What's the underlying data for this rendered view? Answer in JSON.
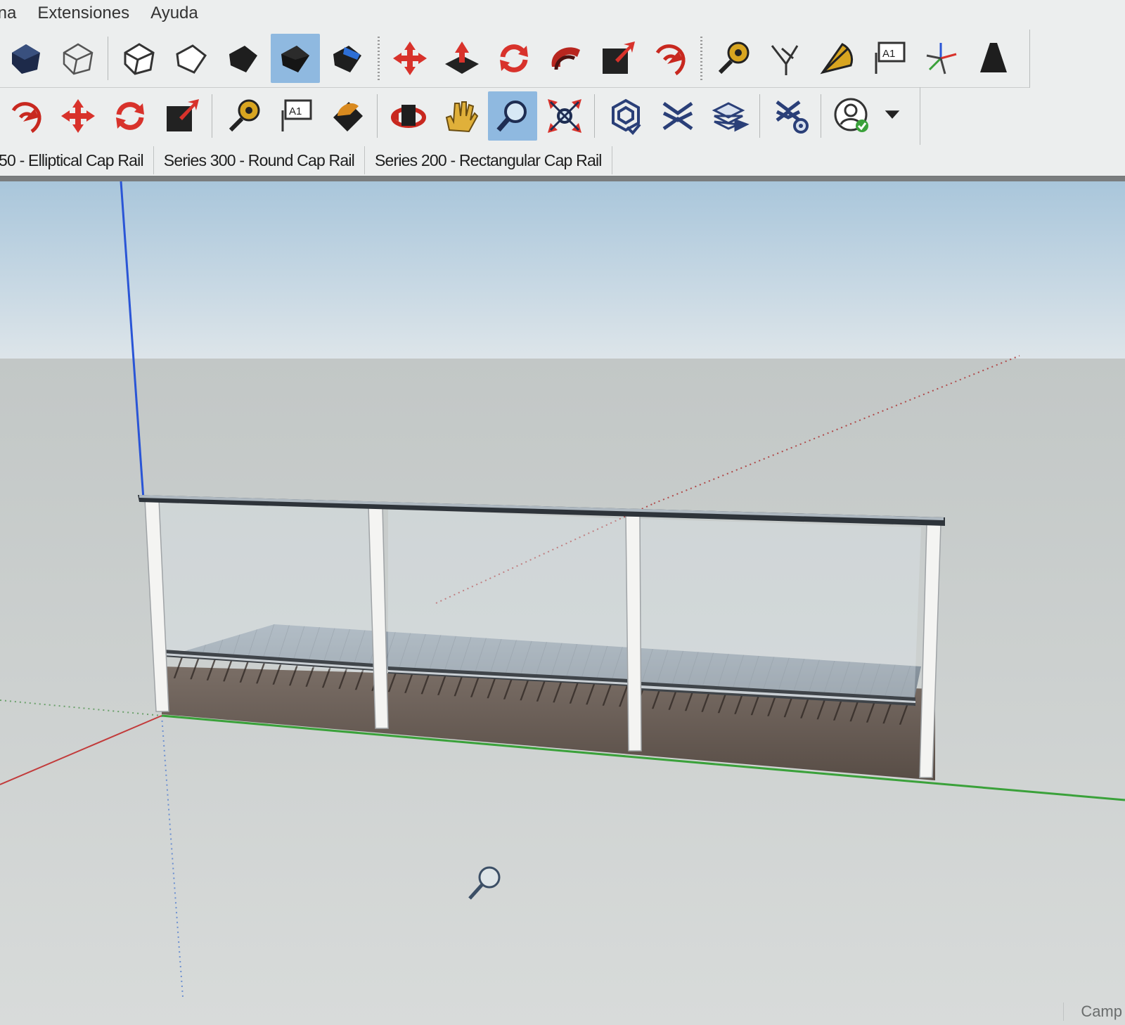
{
  "menubar": {
    "items": [
      "ına",
      "Extensiones",
      "Ayuda"
    ]
  },
  "toolbar_row1": [
    {
      "icon": "x-ray-style-icon"
    },
    {
      "icon": "wireframe-cube-icon"
    },
    {
      "icon": "hidden-line-cube-icon"
    },
    {
      "icon": "shaded-outline-cube-icon"
    },
    {
      "icon": "shaded-cube-icon"
    },
    {
      "icon": "shaded-textures-cube-icon",
      "active": true
    },
    {
      "icon": "monochrome-cube-icon"
    },
    {
      "icon": "move-icon"
    },
    {
      "icon": "push-pull-icon"
    },
    {
      "icon": "rotate-icon"
    },
    {
      "icon": "follow-me-icon"
    },
    {
      "icon": "scale-icon"
    },
    {
      "icon": "offset-icon"
    },
    {
      "icon": "tape-measure-icon"
    },
    {
      "icon": "dimension-icon"
    },
    {
      "icon": "protractor-icon"
    },
    {
      "icon": "text-label-icon"
    },
    {
      "icon": "axes-icon"
    },
    {
      "icon": "3d-text-icon"
    }
  ],
  "toolbar_row2": [
    {
      "icon": "offset-icon"
    },
    {
      "icon": "move-icon"
    },
    {
      "icon": "rotate-icon"
    },
    {
      "icon": "scale-icon"
    },
    {
      "icon": "tape-measure-icon"
    },
    {
      "icon": "text-label-icon"
    },
    {
      "icon": "paint-bucket-icon"
    },
    {
      "icon": "orbit-icon"
    },
    {
      "icon": "pan-icon"
    },
    {
      "icon": "zoom-icon",
      "active": true
    },
    {
      "icon": "zoom-extents-icon"
    },
    {
      "icon": "warehouse-icon"
    },
    {
      "icon": "extension-warehouse-icon"
    },
    {
      "icon": "share-model-icon"
    },
    {
      "icon": "extension-manager-icon"
    },
    {
      "icon": "account-icon"
    },
    {
      "icon": "dropdown-arrow-icon"
    }
  ],
  "tabs": [
    {
      "label": "50 - Elliptical Cap Rail"
    },
    {
      "label": "Series 300 - Round Cap Rail"
    },
    {
      "label": "Series 200 - Rectangular Cap Rail"
    }
  ],
  "status": {
    "text": "Camp"
  },
  "colors": {
    "ui_bg": "#eceeee",
    "active_button": "#8fb9e0",
    "sky_top": "#a9c6db",
    "ground": "#c9cdcc",
    "axis_blue": "#2a55d6",
    "axis_red": "#c23b3b",
    "axis_green": "#3aa13a"
  }
}
